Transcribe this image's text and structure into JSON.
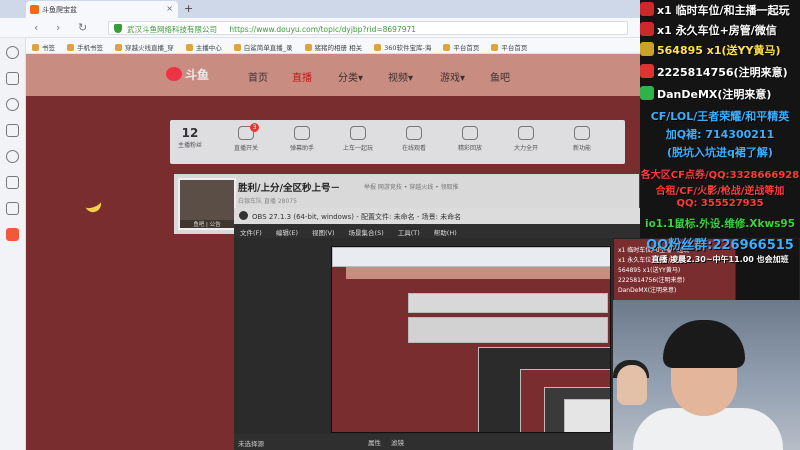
{
  "browser": {
    "tab_title": "斗鱼爬宝盆",
    "new_tab": "+",
    "org_name": "武汉斗鱼网络科技有限公司",
    "url": "https://www.douyu.com/topic/dyjbp?rid=8697971",
    "bookmarks": [
      "书签",
      "手机书签",
      "穿越火线直播_穿",
      "主播中心",
      "白鲨简单直播_录",
      "猪猪的相册 相关",
      "360软件宝库-海",
      "平台首页",
      "平台首页"
    ]
  },
  "site": {
    "logo": "斗鱼",
    "nav": [
      "首页",
      "直播",
      "分类▾",
      "视频▾",
      "游戏▾",
      "鱼吧"
    ],
    "active_nav": "直播",
    "follow_count": "12",
    "follow_label": "主播粉丝",
    "categories": [
      {
        "label": "直播开关",
        "badge": "3"
      },
      {
        "label": "弹幕助手",
        "badge": ""
      },
      {
        "label": "上车一起玩",
        "badge": ""
      },
      {
        "label": "在线观看",
        "badge": ""
      },
      {
        "label": "精彩回放",
        "badge": ""
      },
      {
        "label": "大力全开",
        "badge": ""
      },
      {
        "label": "新功能",
        "badge": ""
      }
    ],
    "room_title": "胜利/上分/全区秒上号－",
    "room_tags": "举报 网游竞技 • 穿越火线 • 领取推",
    "room_meta": "白银车队 直播   28075",
    "avatar_caption": "鱼吧 | 公告"
  },
  "obs": {
    "title": "OBS 27.1.3 (64-bit, windows) - 配置文件: 未命名 - 场景: 未命名",
    "menu": [
      "文件(F)",
      "编辑(E)",
      "视图(V)",
      "场景集合(S)",
      "工具(T)",
      "帮助(H)"
    ],
    "footer_status": "未选择源",
    "footer_buttons": [
      "属性",
      "滤镜"
    ]
  },
  "overlay": {
    "lines": [
      {
        "text": "x1 临时车位/和主播一起玩",
        "color": "#ffffff",
        "icon_color": "#cc2a2a"
      },
      {
        "text": "x1 永久车位+房管/微信",
        "color": "#ffffff",
        "icon_color": "#cc2a2a"
      },
      {
        "text": "564895 x1(送YY黄马)",
        "color": "#ffe14a",
        "icon_color": "#c9a227"
      },
      {
        "text": "2225814756(注明来意)",
        "color": "#ffffff",
        "icon_color": "#d33"
      },
      {
        "text": "DanDeMX(注明来意)",
        "color": "#ffffff",
        "icon_color": "#2db34a"
      },
      {
        "text": "CF/LOL/王者荣耀/和平精英",
        "color": "#3ab0ff",
        "icon_color": ""
      },
      {
        "text": "加Q裙: 714300211",
        "color": "#3ab0ff",
        "icon_color": ""
      },
      {
        "text": "(脱坑入坑进q裙了解)",
        "color": "#3ab0ff",
        "icon_color": ""
      },
      {
        "text": "各大区CF点券/QQ:3328666928",
        "color": "#ff3c3c",
        "icon_color": ""
      },
      {
        "text": "合租/CF/火影/枪战/逆战等加",
        "color": "#ff3c3c",
        "icon_color": ""
      },
      {
        "text": "QQ: 355527935",
        "color": "#ff3c3c",
        "icon_color": ""
      },
      {
        "text": "io1.1鼠标.外设.维修.Xkws95",
        "color": "#3cd33c",
        "icon_color": ""
      },
      {
        "text": "QQ粉丝群:226966515",
        "color": "#3ab0ff",
        "icon_color": ""
      },
      {
        "text": "直播 凌晨2.30~中午11.00 也会加班",
        "color": "#ffffff",
        "icon_color": ""
      }
    ]
  },
  "colors": {
    "page_bg": "#7a2d2e",
    "site_header": "#c98c80",
    "active_nav": "#c21a1a",
    "overlay_bg": "#141414"
  }
}
